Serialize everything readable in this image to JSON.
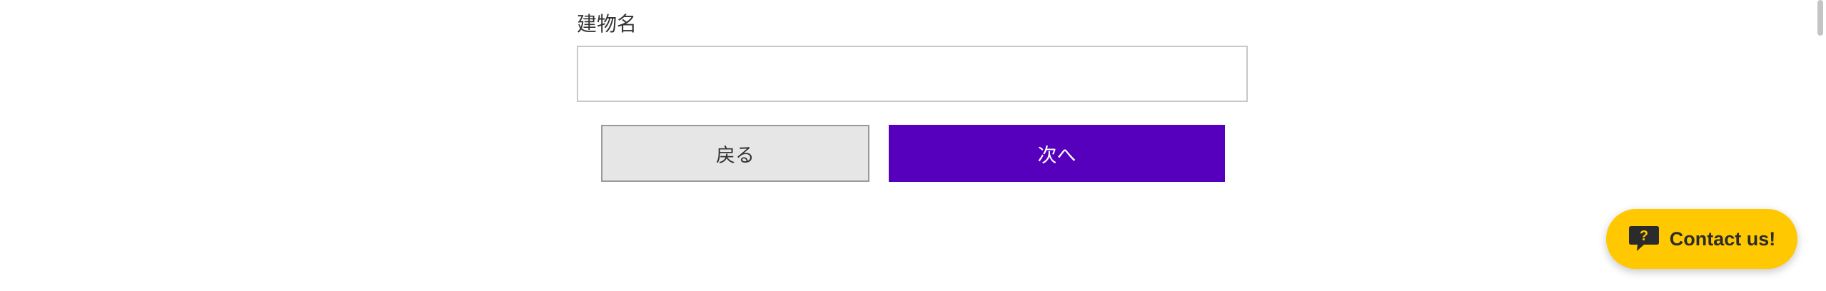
{
  "form": {
    "building_name": {
      "label": "建物名",
      "value": "",
      "placeholder": ""
    },
    "back_label": "戻る",
    "next_label": "次へ"
  },
  "contact": {
    "label": "Contact us!",
    "icon": "question-chat-bubble-icon",
    "color": "#ffc800"
  },
  "colors": {
    "primary": "#5600bd",
    "secondary_bg": "#e6e6e6"
  }
}
